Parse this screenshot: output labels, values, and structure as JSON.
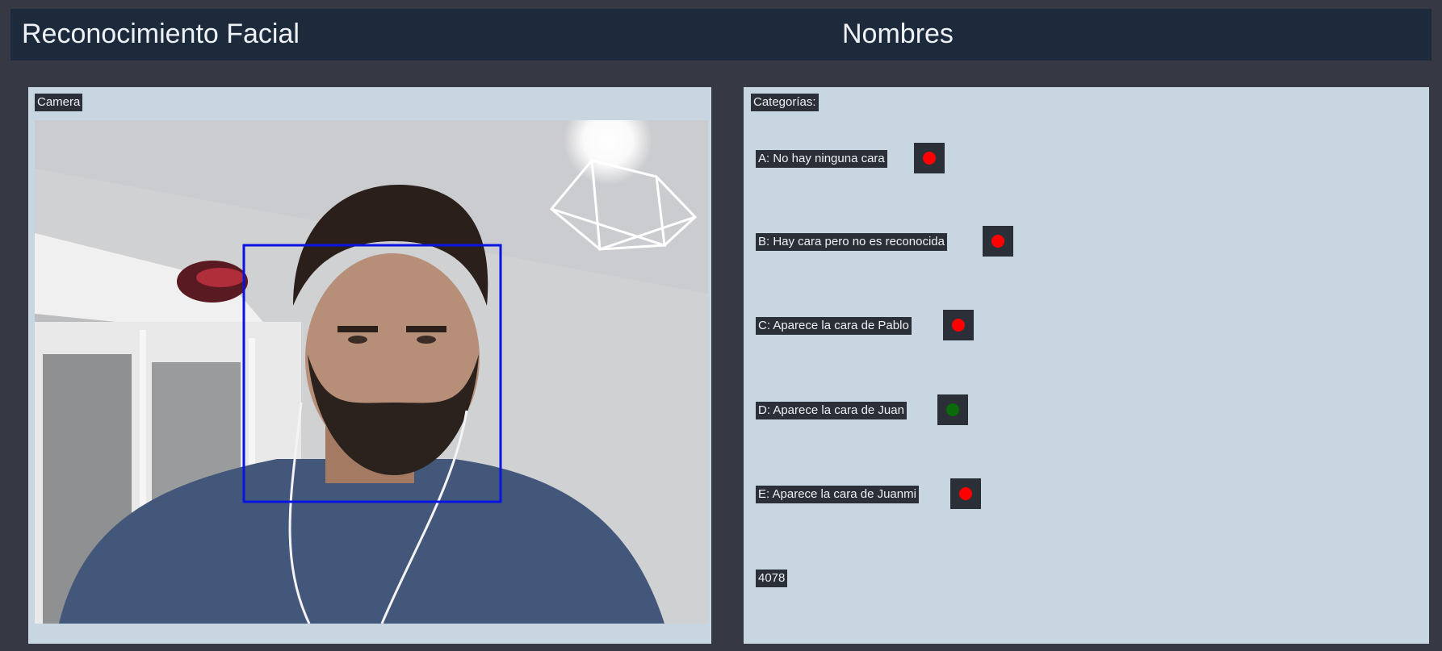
{
  "header": {
    "title": "Reconocimiento Facial",
    "names_label": "Nombres"
  },
  "camera": {
    "label": "Camera",
    "face_box_color": "#0a14e0"
  },
  "categories": {
    "label": "Categorías:",
    "items": [
      {
        "text": "A: No hay ninguna cara",
        "status": "inactive"
      },
      {
        "text": "B: Hay cara pero no es reconocida",
        "status": "inactive"
      },
      {
        "text": "C: Aparece la cara de Pablo",
        "status": "inactive"
      },
      {
        "text": "D: Aparece la cara de Juan",
        "status": "active"
      },
      {
        "text": "E: Aparece la cara de Juanmi",
        "status": "inactive"
      }
    ],
    "counter": "4078"
  },
  "colors": {
    "inactive": "#ff0000",
    "active": "#0a6b0a",
    "background": "#363943",
    "header": "#1d2a3b",
    "panel": "#c8d6e1"
  }
}
